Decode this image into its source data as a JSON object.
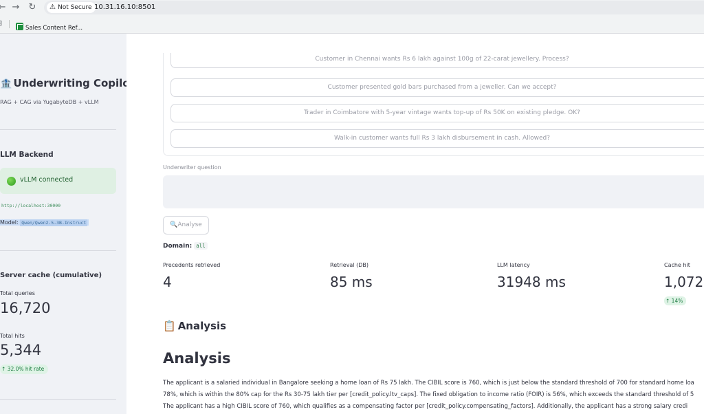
{
  "browser": {
    "secure_label": "Not Secure",
    "url": "10.31.16.10:8501",
    "bookmark_label": "Sales Content Ref..."
  },
  "sidebar": {
    "title": "Underwriting Copilot",
    "subtitle": "RAG + CAG via YugabyteDB + vLLM",
    "llm_heading": "LLM Backend",
    "connection_status": "vLLM connected",
    "endpoint": "http://localhost:30000",
    "model_label": "Model:",
    "model_value": "Qwen/Qwen2.5-3B-Instruct",
    "cache_heading": "Server cache (cumulative)",
    "total_queries_label": "Total queries",
    "total_queries_value": "16,720",
    "total_hits_label": "Total hits",
    "total_hits_value": "5,344",
    "hit_rate_delta": "↑ 32.0% hit rate"
  },
  "main": {
    "examples": [
      "Customer in Chennai wants Rs 6 lakh against 100g of 22-carat jewellery. Process?",
      "Customer presented gold bars purchased from a jeweller. Can we accept?",
      "Trader in Coimbatore with 5-year vintage wants top-up of Rs 50K on existing pledge. OK?",
      "Walk-in customer wants full Rs 3 lakh disbursement in cash. Allowed?"
    ],
    "question_label": "Underwriter question",
    "question_value": "",
    "analyse_label": "Analyse",
    "domain_label": "Domain:",
    "domain_value": "all",
    "metrics": [
      {
        "label": "Precedents retrieved",
        "value": "4"
      },
      {
        "label": "Retrieval (DB)",
        "value": "85 ms"
      },
      {
        "label": "LLM latency",
        "value": "31948 ms"
      },
      {
        "label": "Cache hit",
        "value": "1,072"
      }
    ],
    "cache_delta": "↑ 14%",
    "analysis_heading_small": "Analysis",
    "analysis_heading_large": "Analysis",
    "paragraph_lines": [
      "The applicant is a salaried individual in Bangalore seeking a home loan of Rs 75 lakh. The CIBIL score is 760, which is just below the standard threshold of 700 for standard home loa",
      "78%, which is within the 80% cap for the Rs 30-75 lakh tier per [credit_policy.ltv_caps]. The fixed obligation to income ratio (FOIR) is 56%, which exceeds the standard threshold of 5",
      "The applicant has a high CIBIL score of 760, which qualifies as a compensating factor per [credit_policy.compensating_factors]. Additionally, the applicant has a strong salary credi"
    ]
  }
}
